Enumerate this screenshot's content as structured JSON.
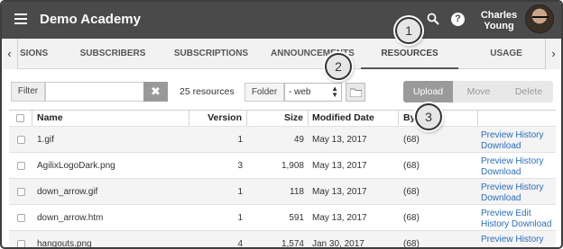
{
  "header": {
    "title": "Demo Academy",
    "user_first": "Charles",
    "user_last": "Young"
  },
  "tabs": [
    {
      "label": "SIONS"
    },
    {
      "label": "SUBSCRIBERS"
    },
    {
      "label": "SUBSCRIPTIONS"
    },
    {
      "label": "ANNOUNCEMENTS"
    },
    {
      "label": "RESOURCES"
    },
    {
      "label": "USAGE"
    }
  ],
  "callouts": [
    "1",
    "2",
    "3"
  ],
  "toolbar": {
    "filter_label": "Filter",
    "filter_value": "",
    "resource_count": "25 resources",
    "folder_label": "Folder",
    "folder_value": "- web",
    "upload": "Upload",
    "move": "Move",
    "delete": "Delete"
  },
  "table": {
    "headers": [
      "Name",
      "Version",
      "Size",
      "Modified Date",
      "By"
    ],
    "rows": [
      {
        "name": "1.gif",
        "version": "1",
        "size": "49",
        "date": "May 13, 2017",
        "by": "(68)",
        "actions": [
          "Preview",
          "History",
          "Download"
        ]
      },
      {
        "name": "AgilixLogoDark.png",
        "version": "3",
        "size": "1,908",
        "date": "May 13, 2017",
        "by": "(68)",
        "actions": [
          "Preview",
          "History",
          "Download"
        ]
      },
      {
        "name": "down_arrow.gif",
        "version": "1",
        "size": "118",
        "date": "May 13, 2017",
        "by": "(68)",
        "actions": [
          "Preview",
          "History",
          "Download"
        ]
      },
      {
        "name": "down_arrow.htm",
        "version": "1",
        "size": "591",
        "date": "May 13, 2017",
        "by": "(68)",
        "actions": [
          "Preview",
          "Edit",
          "History",
          "Download"
        ]
      },
      {
        "name": "hangouts.png",
        "version": "4",
        "size": "1,574",
        "date": "Jan 30, 2017",
        "by": "(68)",
        "actions": [
          "Preview",
          "History"
        ]
      }
    ]
  }
}
